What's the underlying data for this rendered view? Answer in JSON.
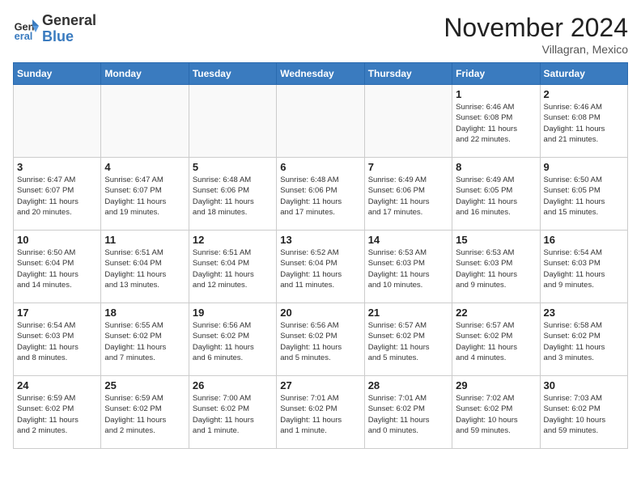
{
  "header": {
    "logo_general": "General",
    "logo_blue": "Blue",
    "month_title": "November 2024",
    "location": "Villagran, Mexico"
  },
  "days_of_week": [
    "Sunday",
    "Monday",
    "Tuesday",
    "Wednesday",
    "Thursday",
    "Friday",
    "Saturday"
  ],
  "weeks": [
    [
      {
        "day": "",
        "info": ""
      },
      {
        "day": "",
        "info": ""
      },
      {
        "day": "",
        "info": ""
      },
      {
        "day": "",
        "info": ""
      },
      {
        "day": "",
        "info": ""
      },
      {
        "day": "1",
        "info": "Sunrise: 6:46 AM\nSunset: 6:08 PM\nDaylight: 11 hours\nand 22 minutes."
      },
      {
        "day": "2",
        "info": "Sunrise: 6:46 AM\nSunset: 6:08 PM\nDaylight: 11 hours\nand 21 minutes."
      }
    ],
    [
      {
        "day": "3",
        "info": "Sunrise: 6:47 AM\nSunset: 6:07 PM\nDaylight: 11 hours\nand 20 minutes."
      },
      {
        "day": "4",
        "info": "Sunrise: 6:47 AM\nSunset: 6:07 PM\nDaylight: 11 hours\nand 19 minutes."
      },
      {
        "day": "5",
        "info": "Sunrise: 6:48 AM\nSunset: 6:06 PM\nDaylight: 11 hours\nand 18 minutes."
      },
      {
        "day": "6",
        "info": "Sunrise: 6:48 AM\nSunset: 6:06 PM\nDaylight: 11 hours\nand 17 minutes."
      },
      {
        "day": "7",
        "info": "Sunrise: 6:49 AM\nSunset: 6:06 PM\nDaylight: 11 hours\nand 17 minutes."
      },
      {
        "day": "8",
        "info": "Sunrise: 6:49 AM\nSunset: 6:05 PM\nDaylight: 11 hours\nand 16 minutes."
      },
      {
        "day": "9",
        "info": "Sunrise: 6:50 AM\nSunset: 6:05 PM\nDaylight: 11 hours\nand 15 minutes."
      }
    ],
    [
      {
        "day": "10",
        "info": "Sunrise: 6:50 AM\nSunset: 6:04 PM\nDaylight: 11 hours\nand 14 minutes."
      },
      {
        "day": "11",
        "info": "Sunrise: 6:51 AM\nSunset: 6:04 PM\nDaylight: 11 hours\nand 13 minutes."
      },
      {
        "day": "12",
        "info": "Sunrise: 6:51 AM\nSunset: 6:04 PM\nDaylight: 11 hours\nand 12 minutes."
      },
      {
        "day": "13",
        "info": "Sunrise: 6:52 AM\nSunset: 6:04 PM\nDaylight: 11 hours\nand 11 minutes."
      },
      {
        "day": "14",
        "info": "Sunrise: 6:53 AM\nSunset: 6:03 PM\nDaylight: 11 hours\nand 10 minutes."
      },
      {
        "day": "15",
        "info": "Sunrise: 6:53 AM\nSunset: 6:03 PM\nDaylight: 11 hours\nand 9 minutes."
      },
      {
        "day": "16",
        "info": "Sunrise: 6:54 AM\nSunset: 6:03 PM\nDaylight: 11 hours\nand 9 minutes."
      }
    ],
    [
      {
        "day": "17",
        "info": "Sunrise: 6:54 AM\nSunset: 6:03 PM\nDaylight: 11 hours\nand 8 minutes."
      },
      {
        "day": "18",
        "info": "Sunrise: 6:55 AM\nSunset: 6:02 PM\nDaylight: 11 hours\nand 7 minutes."
      },
      {
        "day": "19",
        "info": "Sunrise: 6:56 AM\nSunset: 6:02 PM\nDaylight: 11 hours\nand 6 minutes."
      },
      {
        "day": "20",
        "info": "Sunrise: 6:56 AM\nSunset: 6:02 PM\nDaylight: 11 hours\nand 5 minutes."
      },
      {
        "day": "21",
        "info": "Sunrise: 6:57 AM\nSunset: 6:02 PM\nDaylight: 11 hours\nand 5 minutes."
      },
      {
        "day": "22",
        "info": "Sunrise: 6:57 AM\nSunset: 6:02 PM\nDaylight: 11 hours\nand 4 minutes."
      },
      {
        "day": "23",
        "info": "Sunrise: 6:58 AM\nSunset: 6:02 PM\nDaylight: 11 hours\nand 3 minutes."
      }
    ],
    [
      {
        "day": "24",
        "info": "Sunrise: 6:59 AM\nSunset: 6:02 PM\nDaylight: 11 hours\nand 2 minutes."
      },
      {
        "day": "25",
        "info": "Sunrise: 6:59 AM\nSunset: 6:02 PM\nDaylight: 11 hours\nand 2 minutes."
      },
      {
        "day": "26",
        "info": "Sunrise: 7:00 AM\nSunset: 6:02 PM\nDaylight: 11 hours\nand 1 minute."
      },
      {
        "day": "27",
        "info": "Sunrise: 7:01 AM\nSunset: 6:02 PM\nDaylight: 11 hours\nand 1 minute."
      },
      {
        "day": "28",
        "info": "Sunrise: 7:01 AM\nSunset: 6:02 PM\nDaylight: 11 hours\nand 0 minutes."
      },
      {
        "day": "29",
        "info": "Sunrise: 7:02 AM\nSunset: 6:02 PM\nDaylight: 10 hours\nand 59 minutes."
      },
      {
        "day": "30",
        "info": "Sunrise: 7:03 AM\nSunset: 6:02 PM\nDaylight: 10 hours\nand 59 minutes."
      }
    ]
  ]
}
